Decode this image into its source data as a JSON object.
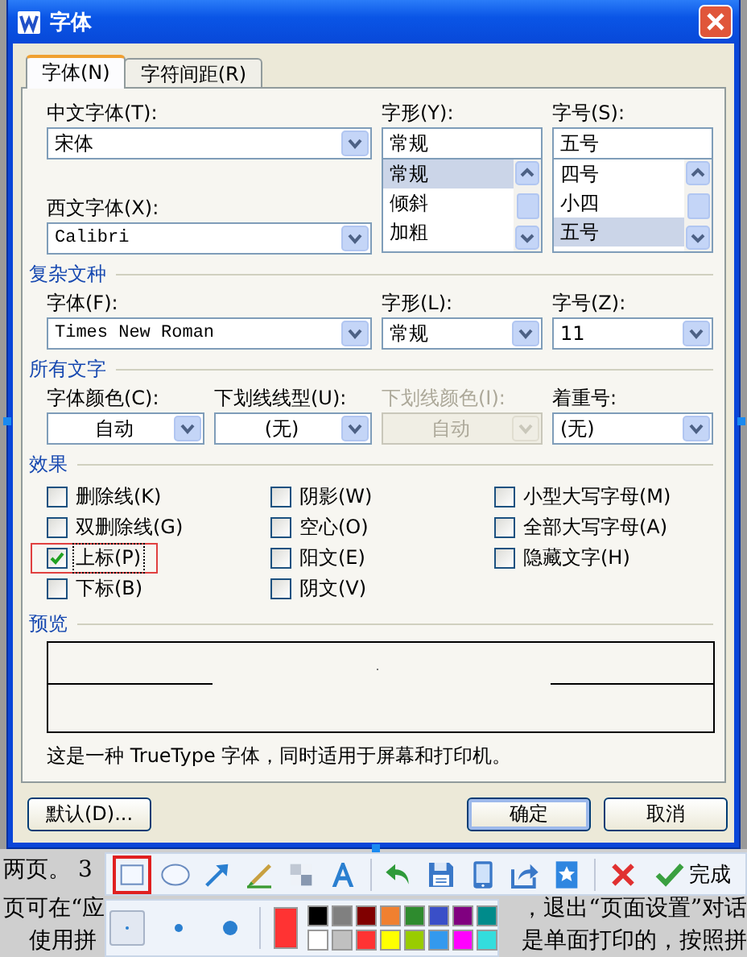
{
  "window": {
    "title": "字体"
  },
  "tabs": [
    {
      "label": "字体(N)",
      "selected": true
    },
    {
      "label": "字符间距(R)",
      "selected": false
    }
  ],
  "font": {
    "chinese_font": {
      "label": "中文字体(T):",
      "value": "宋体"
    },
    "western_font": {
      "label": "西文字体(X):",
      "value": "Calibri"
    },
    "style": {
      "label": "字形(Y):",
      "value": "常规",
      "options": [
        {
          "label": "常规",
          "selected": true
        },
        {
          "label": "倾斜",
          "selected": false
        },
        {
          "label": "加粗",
          "selected": false
        }
      ]
    },
    "size": {
      "label": "字号(S):",
      "value": "五号",
      "options": [
        {
          "label": "四号",
          "selected": false
        },
        {
          "label": "小四",
          "selected": false
        },
        {
          "label": "五号",
          "selected": true
        }
      ]
    }
  },
  "complex_script": {
    "title": "复杂文种",
    "fields": [
      {
        "label": "字体(F):",
        "value": "Times New Roman",
        "disabled": false
      },
      {
        "label": "字形(L):",
        "value": "常规",
        "disabled": false
      },
      {
        "label": "字号(Z):",
        "value": "11",
        "disabled": false
      }
    ]
  },
  "all_text": {
    "title": "所有文字",
    "fields": [
      {
        "label": "字体颜色(C):",
        "value": "自动",
        "disabled": false
      },
      {
        "label": "下划线线型(U):",
        "value": "(无)",
        "disabled": false
      },
      {
        "label": "下划线颜色(I):",
        "value": "自动",
        "disabled": true
      },
      {
        "label": "着重号:",
        "value": "(无)",
        "disabled": false
      }
    ]
  },
  "effects": {
    "title": "效果",
    "columns": [
      [
        {
          "label": "删除线(K)",
          "checked": false,
          "annotated": false
        },
        {
          "label": "双删除线(G)",
          "checked": false,
          "annotated": false
        },
        {
          "label": "上标(P)",
          "checked": true,
          "annotated": true
        },
        {
          "label": "下标(B)",
          "checked": false,
          "annotated": false
        }
      ],
      [
        {
          "label": "阴影(W)",
          "checked": false,
          "annotated": false
        },
        {
          "label": "空心(O)",
          "checked": false,
          "annotated": false
        },
        {
          "label": "阳文(E)",
          "checked": false,
          "annotated": false
        },
        {
          "label": "阴文(V)",
          "checked": false,
          "annotated": false
        }
      ],
      [
        {
          "label": "小型大写字母(M)",
          "checked": false,
          "annotated": false
        },
        {
          "label": "全部大写字母(A)",
          "checked": false,
          "annotated": false
        },
        {
          "label": "隐藏文字(H)",
          "checked": false,
          "annotated": false
        }
      ]
    ]
  },
  "preview": {
    "title": "预览"
  },
  "note": "这是一种 TrueType 字体，同时适用于屏幕和打印机。",
  "buttons": [
    {
      "label": "默认(D)...",
      "default": false
    },
    {
      "label": "确定",
      "default": true
    },
    {
      "label": "取消",
      "default": false
    }
  ],
  "document_lines": [
    {
      "left": "两页。 3"
    },
    {
      "left": "页可在“应",
      "right": "，退出“页面设置”对话"
    },
    {
      "left": "使用拼",
      "right": "是单面打印的，按照拼"
    }
  ],
  "capture_toolbar": {
    "tools": [
      {
        "kind": "rectangle",
        "selected": true
      },
      {
        "kind": "ellipse",
        "selected": false
      },
      {
        "kind": "arrow",
        "selected": false
      },
      {
        "kind": "pen",
        "selected": false
      },
      {
        "kind": "mosaic",
        "selected": false
      },
      {
        "kind": "text",
        "selected": false
      },
      {
        "kind": "separator"
      },
      {
        "kind": "undo"
      },
      {
        "kind": "save"
      },
      {
        "kind": "phone"
      },
      {
        "kind": "share"
      },
      {
        "kind": "pin"
      },
      {
        "kind": "separator"
      },
      {
        "kind": "cancel"
      },
      {
        "kind": "done",
        "label": "完成"
      }
    ],
    "pen_sizes": [
      {
        "selected": true
      },
      {
        "selected": false
      },
      {
        "selected": false
      }
    ],
    "current_swatch": {
      "color": "#ff3333"
    },
    "palette": [
      {
        "color": "#000000"
      },
      {
        "color": "#808080"
      },
      {
        "color": "#800000"
      },
      {
        "color": "#f08030"
      },
      {
        "color": "#2e8b2e"
      },
      {
        "color": "#3a4fc8"
      },
      {
        "color": "#800080"
      },
      {
        "color": "#008b8b"
      },
      {
        "color": "#ffffff"
      },
      {
        "color": "#c0c0c0"
      },
      {
        "color": "#ff3333"
      },
      {
        "color": "#ffff00"
      },
      {
        "color": "#99cc00"
      },
      {
        "color": "#3399ee"
      },
      {
        "color": "#ff00ff"
      },
      {
        "color": "#33dddd"
      }
    ]
  }
}
